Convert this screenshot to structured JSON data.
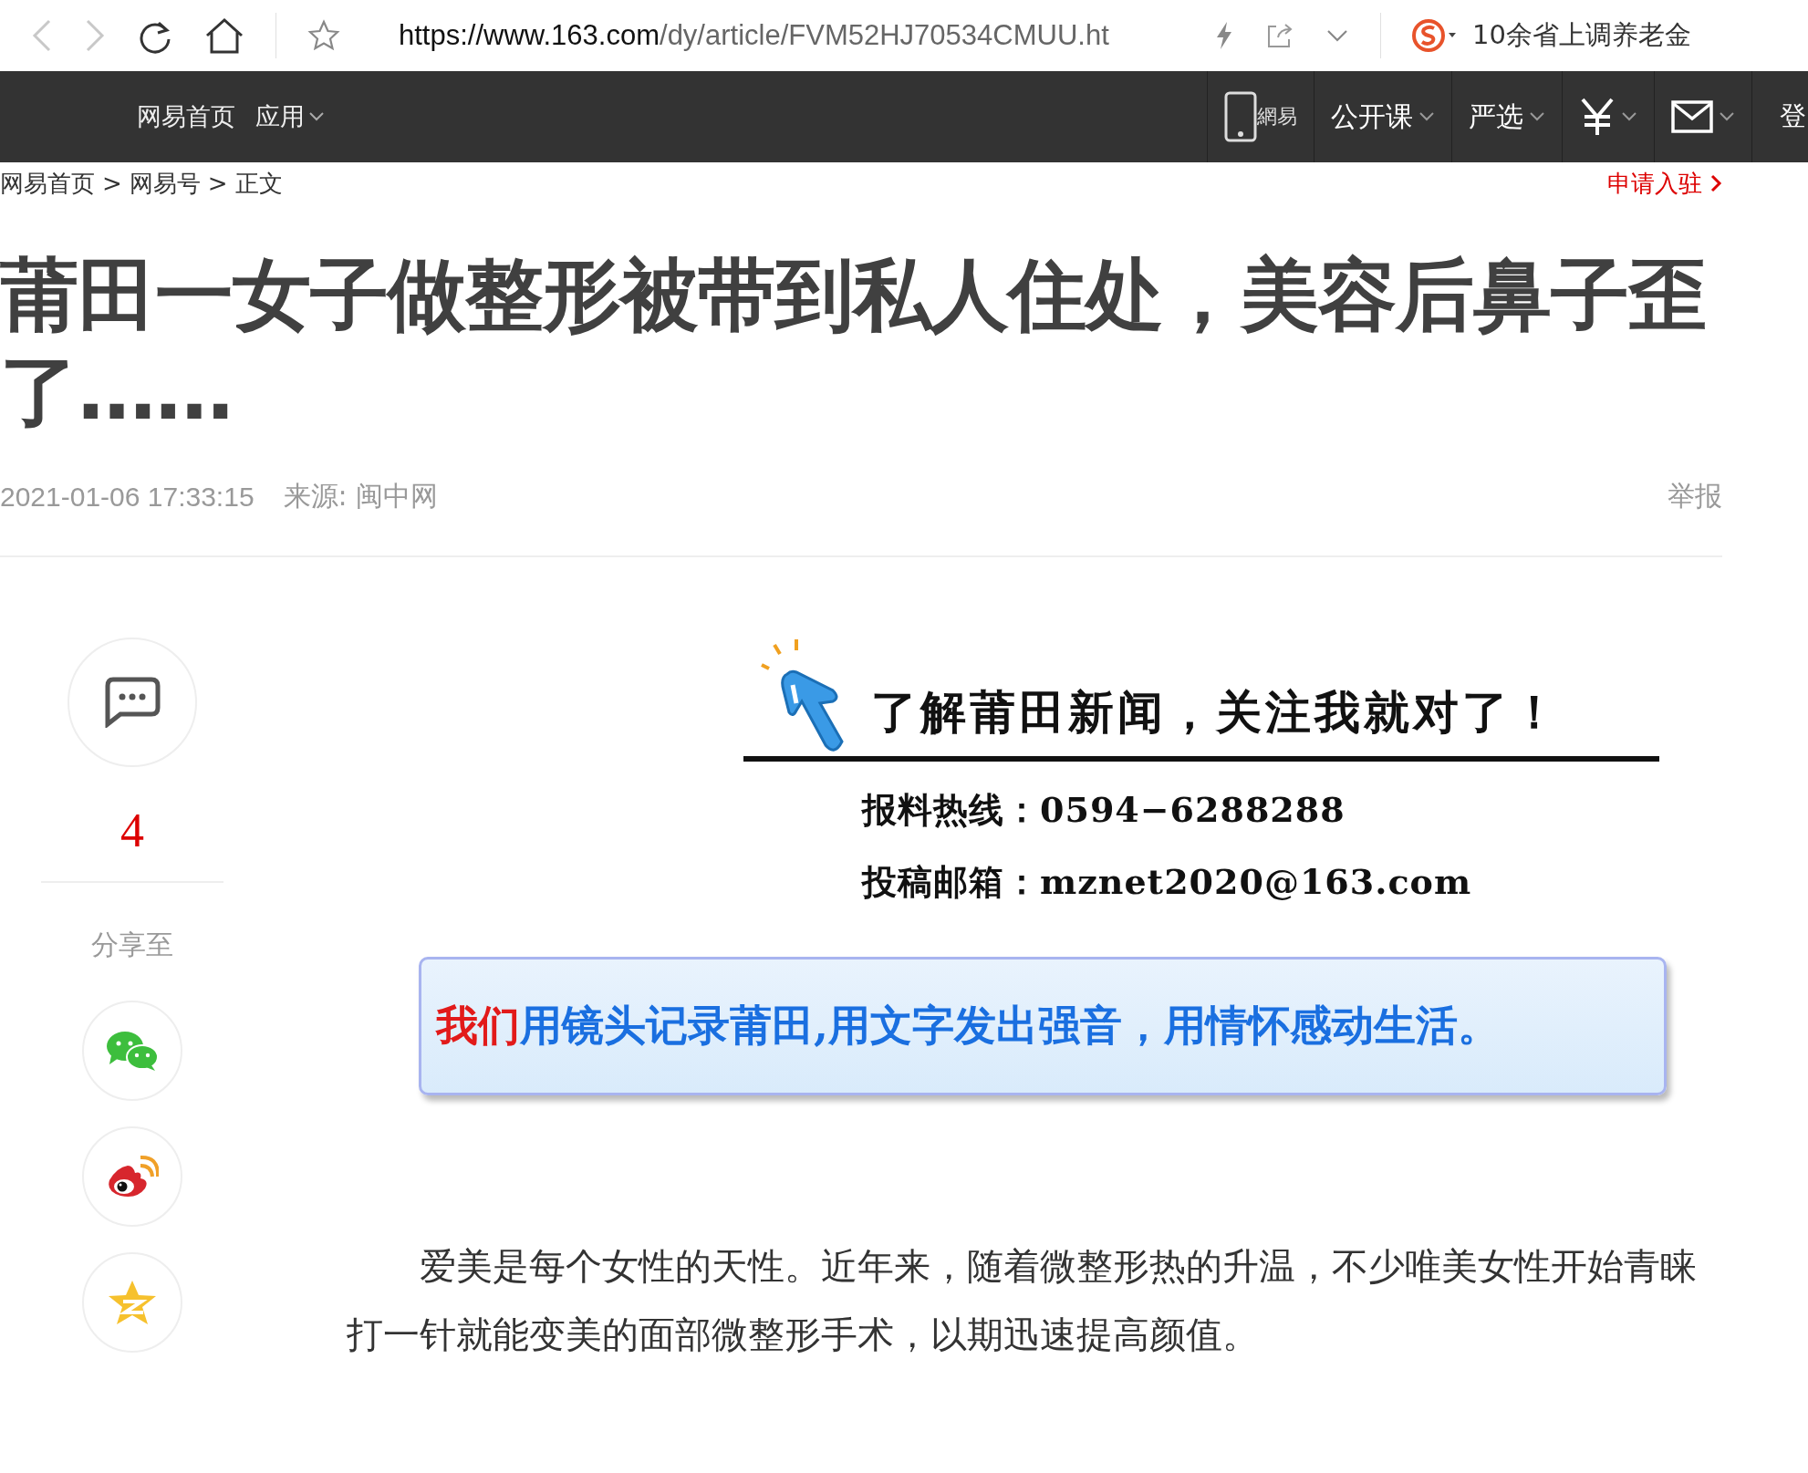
{
  "browser": {
    "url_host": "https://www.163.com",
    "url_path": "/dy/article/FVM52HJ70534CMUU.ht",
    "search_hint": "10余省上调养老金"
  },
  "nav": {
    "left": [
      {
        "label": "网易首页",
        "dropdown": false
      },
      {
        "label": "应用",
        "dropdown": true
      }
    ],
    "right": [
      {
        "kind": "logo",
        "label": "網易",
        "dropdown": false
      },
      {
        "kind": "text",
        "label": "公开课",
        "dropdown": true
      },
      {
        "kind": "text",
        "label": "严选",
        "dropdown": true
      },
      {
        "kind": "yen",
        "dropdown": true
      },
      {
        "kind": "mail",
        "dropdown": true
      }
    ],
    "cut_label": "登"
  },
  "breadcrumb": {
    "items": [
      "网易首页",
      "网易号",
      "正文"
    ],
    "separator": ">"
  },
  "apply_link": "申请入驻",
  "article": {
    "title": "莆田一女子做整形被带到私人住处，美容后鼻子歪了……",
    "time": "2021-01-06 17:33:15",
    "source": "来源: 闽中网",
    "report": "举报",
    "paragraphs": [
      "爱美是每个女性的天性。近年来，随着微整形热的升温，不少唯美女性开始青睐打一针就能变美的面部微整形手术，以期迅速提高颜值。"
    ]
  },
  "sidebar": {
    "comment_count": "4",
    "share_label": "分享至",
    "share": [
      {
        "kind": "wechat"
      },
      {
        "kind": "weibo"
      },
      {
        "kind": "qzone"
      }
    ]
  },
  "banner": {
    "headline": "了解莆田新闻，关注我就对了！",
    "lines": [
      "报料热线：0594−6288288",
      "投稿邮箱：mznet2020@163.com"
    ],
    "slogan_lead": "我们",
    "slogan_rest": "用镜头记录莆田,用文字发出强音，用情怀感动生活。"
  }
}
